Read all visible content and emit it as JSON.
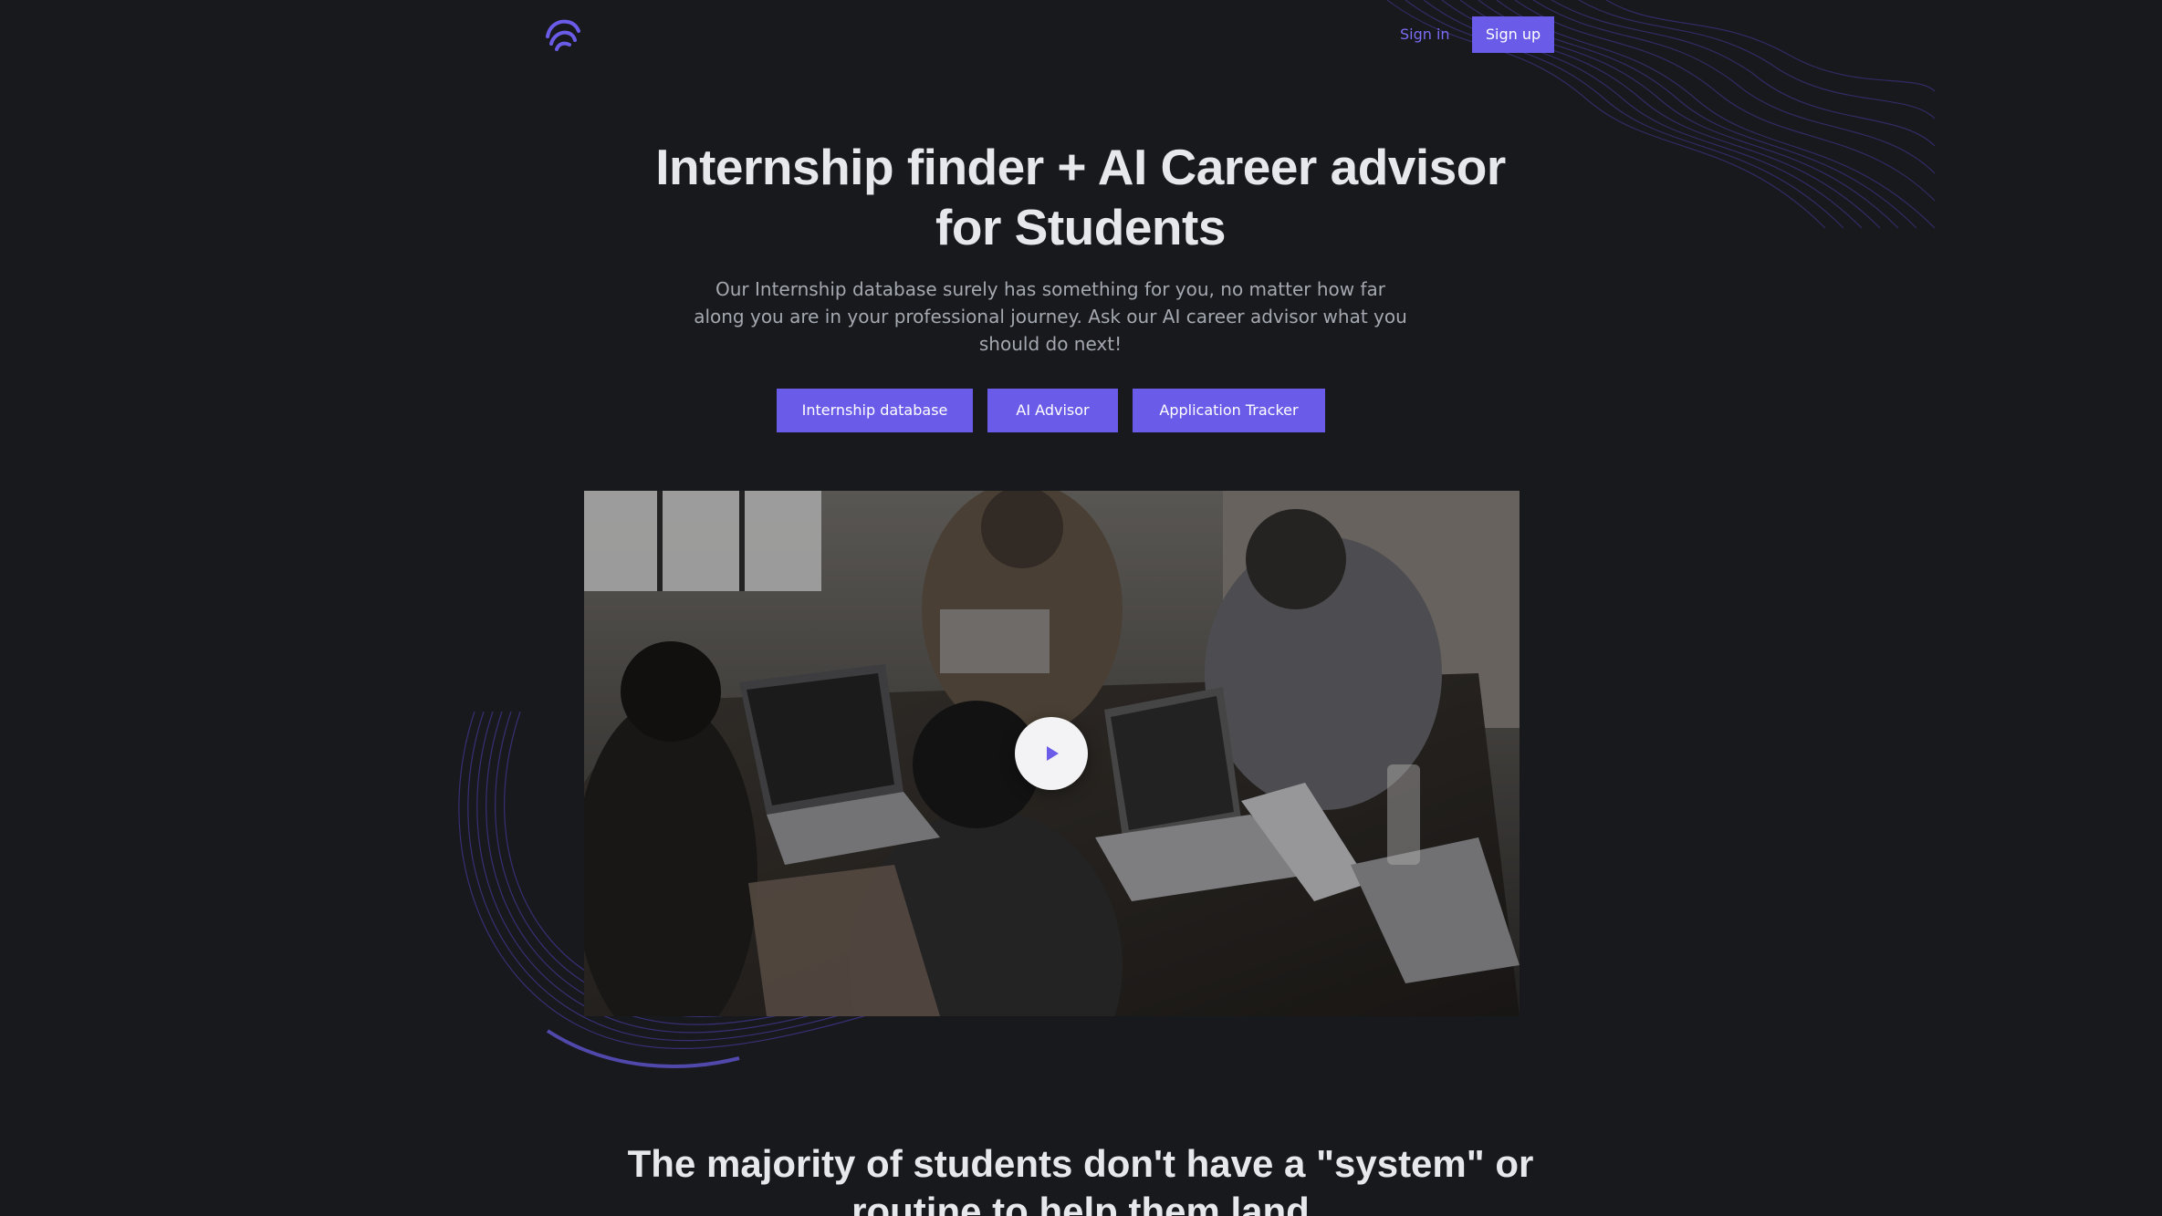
{
  "header": {
    "logo_icon": "brand-logo-icon",
    "signin_label": "Sign in",
    "signup_label": "Sign up"
  },
  "hero": {
    "title": "Internship finder + AI Career advisor for Students",
    "subtitle": "Our Internship database surely has something for you, no matter how far along you are in your professional journey. Ask our AI career advisor what you should do next!",
    "buttons": [
      {
        "label": "Internship database"
      },
      {
        "label": "AI Advisor"
      },
      {
        "label": "Application Tracker"
      }
    ]
  },
  "video": {
    "play_icon": "play-icon"
  },
  "section": {
    "title": "The majority of students don't have a \"system\" or routine to help them land"
  },
  "colors": {
    "background": "#18191c",
    "accent": "#6a5ce8",
    "link": "#7b6cf6",
    "heading": "#e6e8ec",
    "body_text": "#a4a8b0"
  }
}
